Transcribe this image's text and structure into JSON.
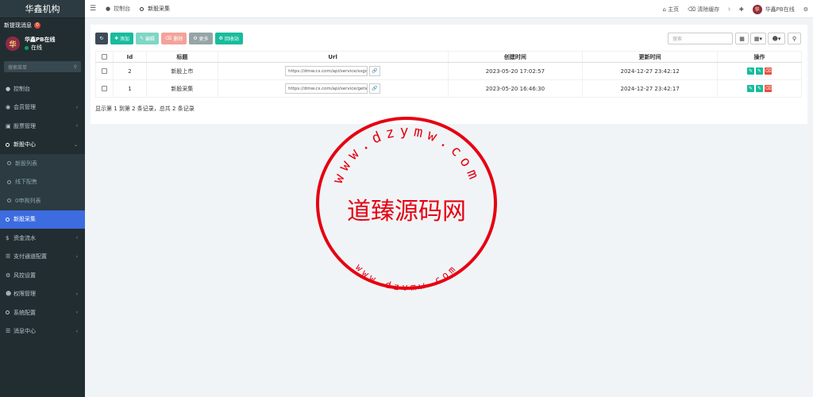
{
  "sidebar": {
    "brand": "华鑫机构",
    "new_msg_label": "新提现消息",
    "new_msg_count": "0",
    "user_name": "华鑫PB在线",
    "user_status": "在线",
    "avatar_text": "华",
    "search_placeholder": "搜索菜单",
    "items": [
      {
        "label": "控制台",
        "icon": "dashboard-icon"
      },
      {
        "label": "会员管理",
        "icon": "user-circle-icon"
      },
      {
        "label": "股票管理",
        "icon": "bank-icon"
      },
      {
        "label": "新股中心",
        "icon": "circle-icon"
      },
      {
        "label": "新股列表",
        "icon": "circle-icon"
      },
      {
        "label": "线下配售",
        "icon": "circle-icon"
      },
      {
        "label": "0申购列表",
        "icon": "circle-icon"
      },
      {
        "label": "新股采集",
        "icon": "circle-icon"
      },
      {
        "label": "资金流水",
        "icon": "dollar-icon"
      },
      {
        "label": "支付通道配置",
        "icon": "list-icon"
      },
      {
        "label": "风控设置",
        "icon": "gear-icon"
      },
      {
        "label": "权限管理",
        "icon": "group-icon"
      },
      {
        "label": "系统配置",
        "icon": "circle-icon"
      },
      {
        "label": "消息中心",
        "icon": "list-icon"
      }
    ]
  },
  "header": {
    "tabs": [
      {
        "label": "控制台",
        "icon": "dashboard-icon"
      },
      {
        "label": "新股采集",
        "icon": "circle-icon"
      }
    ],
    "home_label": "主页",
    "clear_cache_label": "清除缓存",
    "user_label": "华鑫PB在线"
  },
  "toolbar": {
    "add_label": "添加",
    "edit_label": "编辑",
    "delete_label": "删除",
    "more_label": "更多",
    "recycle_label": "回收站",
    "search_placeholder": "搜索"
  },
  "table": {
    "columns": [
      "Id",
      "标题",
      "Url",
      "创建时间",
      "更新时间",
      "操作"
    ],
    "rows": [
      {
        "id": "2",
        "title": "新股上市",
        "url": "https://dmw.cs.com/api/service/ssgc",
        "created": "2023-05-20 17:02:57",
        "updated": "2024-12-27 23:42:12"
      },
      {
        "id": "1",
        "title": "新股采集",
        "url": "https://dmw.cs.com/api/service/getxl",
        "created": "2023-05-20 16:46:30",
        "updated": "2024-12-27 23:42:17"
      }
    ],
    "summary": "显示第 1 到第 2 条记录，总共 2 条记录"
  },
  "watermark": {
    "center_text": "道臻源码网",
    "top_arc": "www.dzymw.com",
    "bottom_arc": "www.dzymw.com",
    "color": "#e60012"
  },
  "colors": {
    "sidebar_bg": "#222d32",
    "active_menu": "#3d6ce0",
    "success": "#18bc9c",
    "danger": "#e74c3c"
  }
}
